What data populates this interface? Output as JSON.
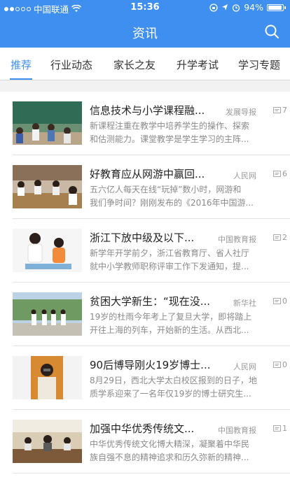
{
  "status_bar": {
    "carrier": "中国联通",
    "time": "15:36",
    "battery": "94%",
    "battery_level": 0.94,
    "signal_dots": 2
  },
  "nav": {
    "title": "资讯",
    "search_icon": "search-icon"
  },
  "tabs": [
    {
      "label": "推荐",
      "active": true
    },
    {
      "label": "行业动态"
    },
    {
      "label": "家长之友"
    },
    {
      "label": "升学考试"
    },
    {
      "label": "学习专题"
    }
  ],
  "articles": [
    {
      "title": "信息技术与小学课程融...",
      "source": "发展导报",
      "comments": "7",
      "summary": [
        "新课程注重在教学中培养学生的操作、探索",
        "和估测能力。课堂教学是学生学习的主阵..."
      ]
    },
    {
      "title": "好教育应从网游中赢回...",
      "source": "人民网",
      "comments": "6",
      "summary": [
        "五六亿人每天在线“玩掉”数小时，网游和",
        "我们争时间？刚刚发布的《2016年中国游..."
      ]
    },
    {
      "title": "浙江下放中级及以下...",
      "source": "中国教育报",
      "comments": "2",
      "summary": [
        "新学年开学前夕，浙江省教育厅、省人社厅",
        "就中小学教师职称评审工作下发通知，提..."
      ]
    },
    {
      "title": "贫困大学新生：“现在没...",
      "source": "新华社",
      "comments": "0",
      "summary": [
        "19岁的杜雨今年考上了复旦大学，即将踏上",
        "开往上海的列车，开始新的生活。从西北..."
      ]
    },
    {
      "title": "90后博导刚火19岁博士...",
      "source": "人民网",
      "comments": "0",
      "summary": [
        "8月29日，西北大学太白校区报到的日子，地",
        "质学系迎来了一名年仅19岁的博士研究生..."
      ]
    },
    {
      "title": "加强中华优秀传统文...",
      "source": "中国教育报",
      "comments": "1",
      "summary": [
        "中华优秀传统文化博大精深，凝聚着中华民",
        "族自强不息的精神追求和历久弥新的精神..."
      ]
    }
  ]
}
